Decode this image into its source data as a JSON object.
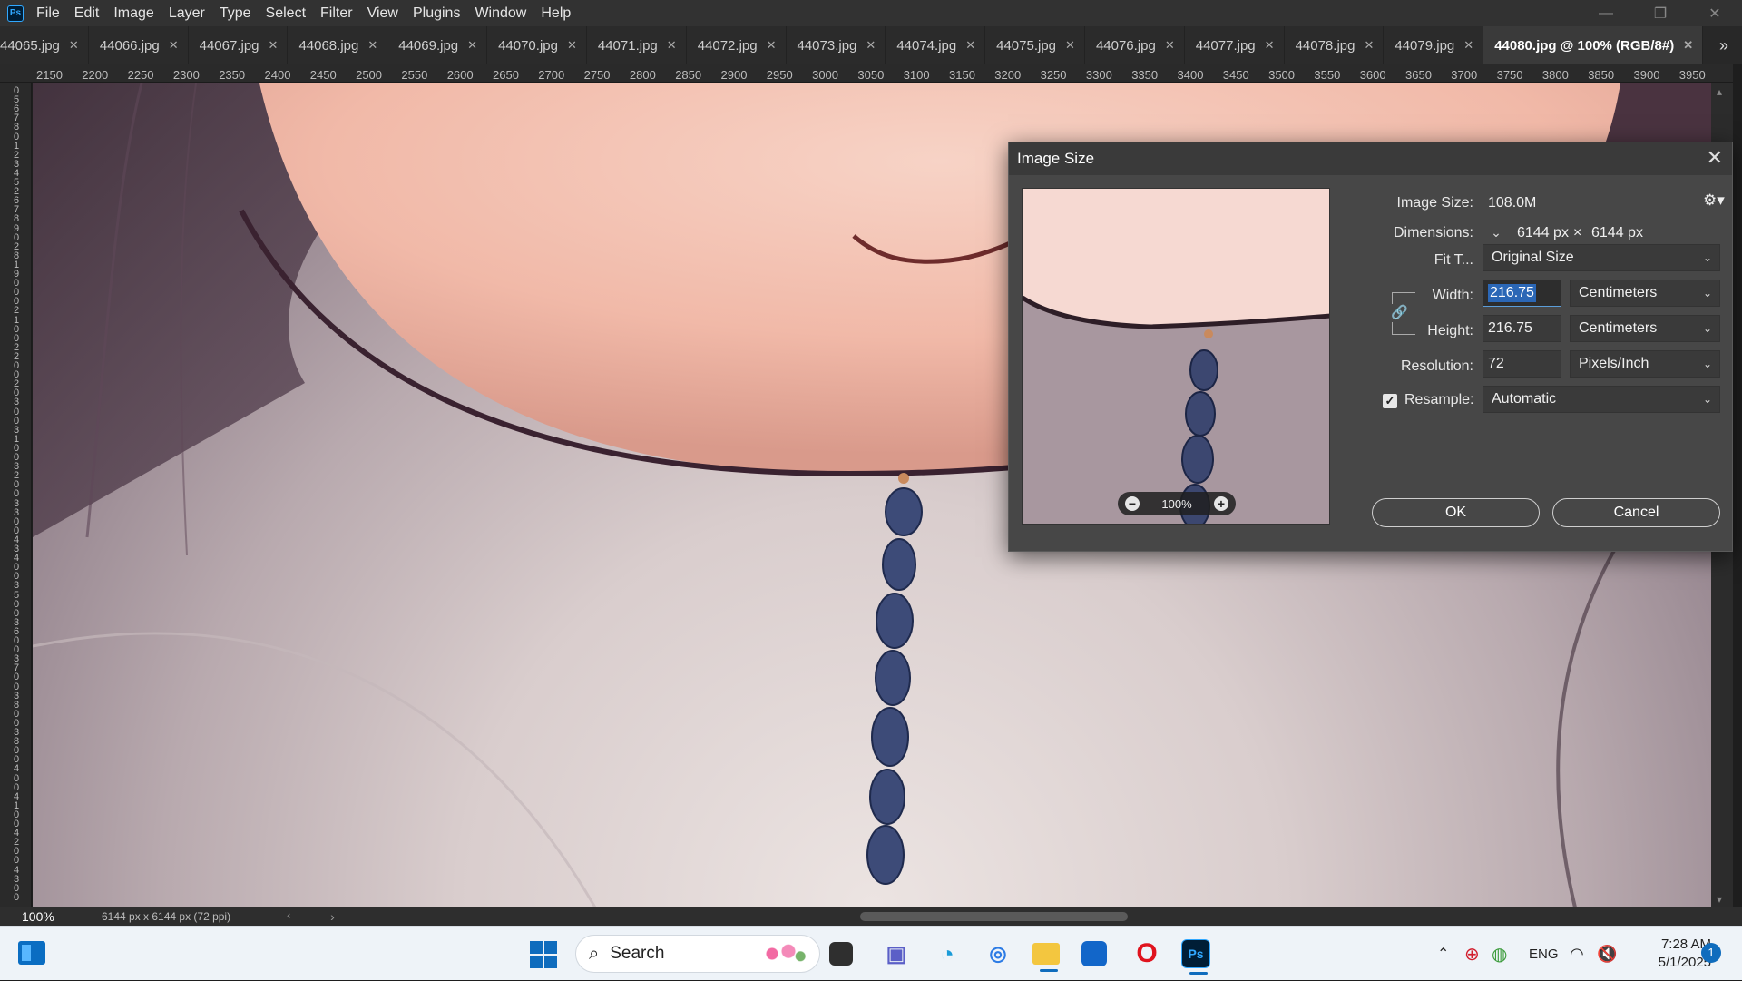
{
  "app": {
    "logo": "Ps"
  },
  "menu": [
    "File",
    "Edit",
    "Image",
    "Layer",
    "Type",
    "Select",
    "Filter",
    "View",
    "Plugins",
    "Window",
    "Help"
  ],
  "window_controls": {
    "minimize": "—",
    "restore": "❐",
    "close": "✕"
  },
  "tabs": [
    {
      "label": "44065.jpg",
      "active": false
    },
    {
      "label": "44066.jpg",
      "active": false
    },
    {
      "label": "44067.jpg",
      "active": false
    },
    {
      "label": "44068.jpg",
      "active": false
    },
    {
      "label": "44069.jpg",
      "active": false
    },
    {
      "label": "44070.jpg",
      "active": false
    },
    {
      "label": "44071.jpg",
      "active": false
    },
    {
      "label": "44072.jpg",
      "active": false
    },
    {
      "label": "44073.jpg",
      "active": false
    },
    {
      "label": "44074.jpg",
      "active": false
    },
    {
      "label": "44075.jpg",
      "active": false
    },
    {
      "label": "44076.jpg",
      "active": false
    },
    {
      "label": "44077.jpg",
      "active": false
    },
    {
      "label": "44078.jpg",
      "active": false
    },
    {
      "label": "44079.jpg",
      "active": false
    },
    {
      "label": "44080.jpg @ 100% (RGB/8#)",
      "active": true
    }
  ],
  "tab_overflow_icon": "»",
  "ruler": {
    "top_ticks": [
      "2150",
      "2200",
      "2250",
      "2300",
      "2350",
      "2400",
      "2450",
      "2500",
      "2550",
      "2600",
      "2650",
      "2700",
      "2750",
      "2800",
      "2850",
      "2900",
      "2950",
      "3000",
      "3050",
      "3100",
      "3150",
      "3200",
      "3250",
      "3300",
      "3350",
      "3400",
      "3450",
      "3500",
      "3550",
      "3600",
      "3650",
      "3700",
      "3750",
      "3800",
      "3850",
      "3900",
      "3950"
    ],
    "left_digits": [
      "0",
      "5",
      "6",
      "7",
      "8",
      "0",
      "1",
      "2",
      "3",
      "4",
      "5",
      "2",
      "6",
      "7",
      "8",
      "9",
      "0",
      "2",
      "8",
      "1",
      "9",
      "0",
      "0",
      "0",
      "2",
      "1",
      "0",
      "0",
      "2",
      "2",
      "0",
      "0",
      "2",
      "0",
      "3",
      "0",
      "0",
      "3",
      "1",
      "0",
      "0",
      "3",
      "2",
      "0",
      "0",
      "3",
      "3",
      "0",
      "0",
      "4",
      "3",
      "4",
      "0",
      "0",
      "3",
      "5",
      "0",
      "0",
      "3",
      "6",
      "0",
      "0",
      "3",
      "7",
      "0",
      "0",
      "3",
      "8",
      "0",
      "0",
      "3",
      "8",
      "0",
      "0",
      "4",
      "0",
      "0",
      "4",
      "1",
      "0",
      "0",
      "4",
      "2",
      "0",
      "0",
      "4",
      "3",
      "0",
      "0"
    ]
  },
  "status": {
    "zoom": "100%",
    "info": "6144 px x 6144 px (72 ppi)",
    "arrow": "›"
  },
  "dialog": {
    "title": "Image Size",
    "close_icon": "✕",
    "preview_zoom": "100%",
    "image_size_label": "Image Size:",
    "image_size_value": "108.0M",
    "dimensions_label": "Dimensions:",
    "dim_w": "6144 px",
    "dim_x": "×",
    "dim_h": "6144 px",
    "fit_label": "Fit T...",
    "fit_value": "Original Size",
    "width_label": "Width:",
    "width_value": "216.75",
    "width_unit": "Centimeters",
    "height_label": "Height:",
    "height_value": "216.75",
    "height_unit": "Centimeters",
    "resolution_label": "Resolution:",
    "resolution_value": "72",
    "resolution_unit": "Pixels/Inch",
    "resample_label": "Resample:",
    "resample_checked": true,
    "resample_value": "Automatic",
    "ok_label": "OK",
    "cancel_label": "Cancel"
  },
  "taskbar": {
    "search_placeholder": "Search",
    "tray_language": "ENG",
    "time": "7:28 AM",
    "date": "5/1/2025",
    "notification_count": "1"
  },
  "colors": {
    "ps_blue": "#31a8ff",
    "dialog_bg": "#474747",
    "selection": "#2b67b6",
    "taskbar_bg": "#eef3f8"
  }
}
